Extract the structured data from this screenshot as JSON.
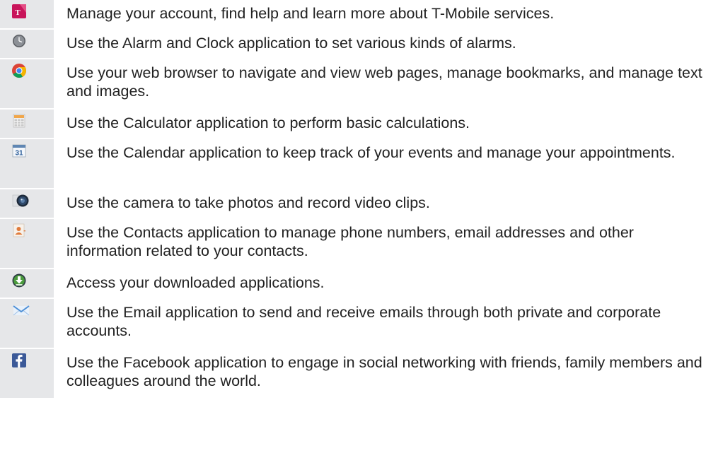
{
  "apps": [
    {
      "icon": "t-mobile-logo-icon",
      "text": "Manage your account, find help and learn more about T-Mobile services."
    },
    {
      "icon": "clock-icon",
      "text": "Use the Alarm and Clock application to set various kinds of alarms."
    },
    {
      "icon": "chrome-browser-icon",
      "text": "Use your web browser to navigate and view web pages, manage bookmarks, and manage text and images."
    },
    {
      "icon": "calculator-icon",
      "text": "Use the Calculator application to perform basic calculations."
    },
    {
      "icon": "calendar-icon",
      "calendar_day": "31",
      "text": "Use the Calendar application to keep track of your events and manage your appointments."
    },
    {
      "icon": "camera-icon",
      "text": "Use the camera to take photos and record video clips."
    },
    {
      "icon": "contacts-icon",
      "text": "Use the Contacts application to manage phone numbers, email addresses and other information related to your contacts."
    },
    {
      "icon": "download-icon",
      "text": "Access your downloaded applications."
    },
    {
      "icon": "email-envelope-icon",
      "text": "Use the Email application to send and receive emails through both private and corporate accounts."
    },
    {
      "icon": "facebook-icon",
      "text": "Use the Facebook application to engage in social networking with friends, family members and colleagues around the world."
    }
  ]
}
